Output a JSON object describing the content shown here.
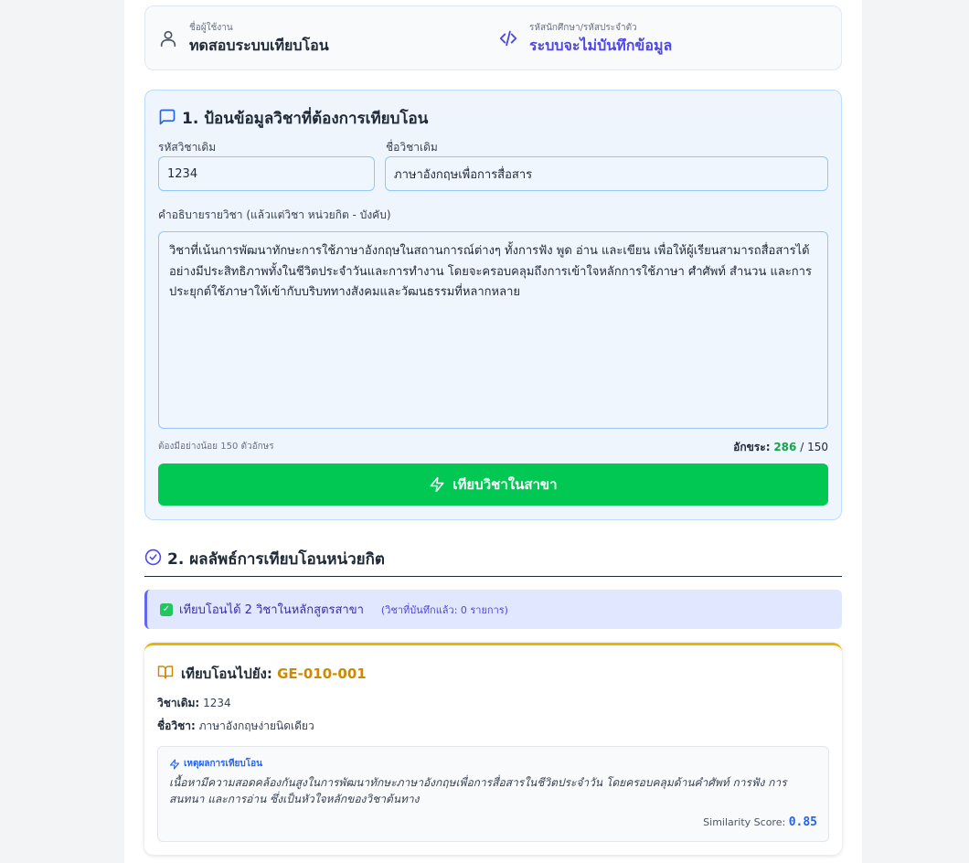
{
  "user_info": {
    "user_label": "ชื่อผู้ใช้งาน",
    "user_value": "ทดสอบระบบเทียบโอน",
    "student_label": "รหัสนักศึกษา/รหัสประจำตัว",
    "student_value": "ระบบจะไม่บันทึกข้อมูล"
  },
  "section1": {
    "title": "1. ป้อนข้อมูลวิชาที่ต้องการเทียบโอน",
    "code_label": "รหัสวิชาเดิม",
    "code_value": "1234",
    "name_label": "ชื่อวิชาเดิม",
    "name_value": "ภาษาอังกฤษเพื่อการสื่อสาร",
    "desc_label": "คำอธิบายรายวิชา (แล้วแต่วิชา หน่วยกิต - บังคับ)",
    "desc_value": "วิชาที่เน้นการพัฒนาทักษะการใช้ภาษาอังกฤษในสถานการณ์ต่างๆ ทั้งการฟัง พูด อ่าน และเขียน เพื่อให้ผู้เรียนสามารถสื่อสารได้อย่างมีประสิทธิภาพทั้งในชีวิตประจำวันและการทำงาน โดยจะครอบคลุมถึงการเข้าใจหลักการใช้ภาษา ศำศัพท์ สำนวน และการประยุกต์ใช้ภาษาให้เข้ากับบริบททางสังคมและวัฒนธรรมที่หลากหลาย",
    "min_hint": "ต้องมีอย่างน้อย 150 ตัวอักษร",
    "counter_label": "อักขระ:",
    "counter_current": "286",
    "counter_separator": "/",
    "counter_min": "150",
    "button_label": "เทียบวิชาในสาขา"
  },
  "section2": {
    "title": "2. ผลลัพธ์การเทียบโอนหน่วยกิต",
    "banner_check": "✓",
    "banner_main": "เทียบโอนได้ 2 วิชาในหลักสูตรสาขา",
    "banner_sub": "(วิชาที่บันทึกแล้ว: 0 รายการ)",
    "result": {
      "title_prefix": "เทียบโอนไปยัง:",
      "target_code": "GE-010-001",
      "orig_code_label": "วิชาเดิม:",
      "orig_code_value": "1234",
      "orig_name_label": "ชื่อวิชา:",
      "orig_name_value": "ภาษาอังกฤษง่ายนิดเดียว",
      "reason_title": "เหตุผลการเทียบโอน",
      "reason_text": "เนื้อหามีความสอดคล้องกันสูงในการพัฒนาทักษะภาษาอังกฤษเพื่อการสื่อสารในชีวิตประจำวัน โดยครอบคลุมด้านคำศัพท์ การฟัง การสนทนา และการอ่าน ซึ่งเป็นหัวใจหลักของวิชาต้นทาง",
      "score_label": "Similarity Score:",
      "score_value": "0.85"
    }
  },
  "icons": {
    "user": "user-icon",
    "code": "code-icon",
    "message": "message-square-icon",
    "zap": "zap-icon",
    "check_circle": "check-circle-icon",
    "check_box": "check-box-icon",
    "book": "book-open-icon"
  },
  "colors": {
    "accent_purple": "#4f46e5",
    "button_green": "#00c853",
    "section_bg": "#eef5fd",
    "result_border": "#eab308",
    "target_code": "#ca8a04",
    "score_blue": "#2563eb"
  }
}
